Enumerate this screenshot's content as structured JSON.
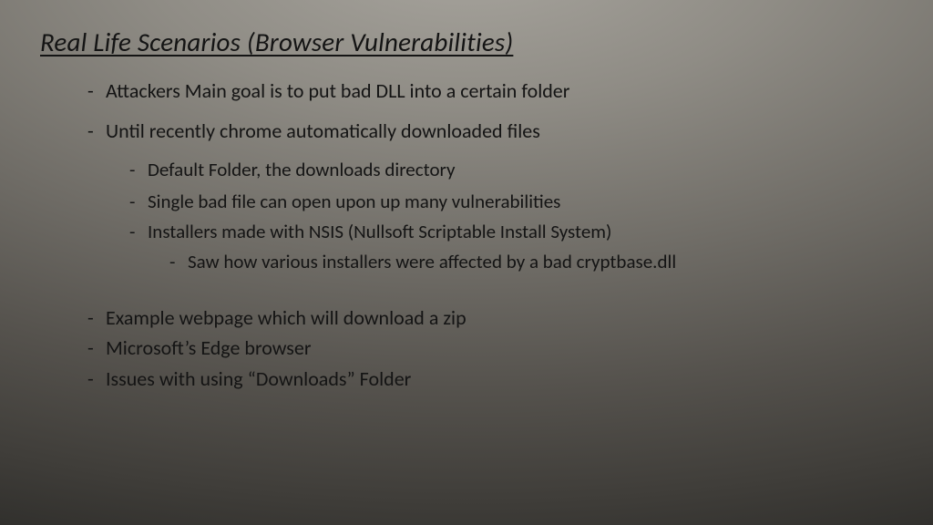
{
  "title": "Real Life Scenarios (Browser Vulnerabilities)",
  "bullets": {
    "b1": "Attackers Main goal is to put bad DLL into a certain folder",
    "b2": "Until recently chrome automatically downloaded files",
    "b2a": "Default Folder, the downloads directory",
    "b2b": "Single bad file can open upon up many vulnerabilities",
    "b2c": "Installers made with NSIS (Nullsoft Scriptable Install System)",
    "b2c1": "Saw how various installers were affected by a bad cryptbase.dll",
    "b3": "Example webpage which will download a zip",
    "b4": "Microsoft’s Edge browser",
    "b5": "Issues with using “Downloads” Folder"
  }
}
